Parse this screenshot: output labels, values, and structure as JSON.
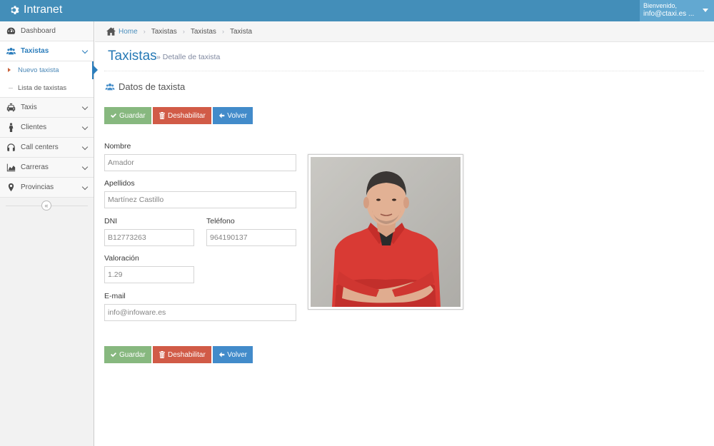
{
  "app": {
    "title": "Intranet"
  },
  "user": {
    "greeting": "Bienvenido,",
    "email": "info@ctaxi.es ..."
  },
  "sidebar": {
    "items": [
      {
        "label": "Dashboard",
        "icon": "dashboard-icon"
      },
      {
        "label": "Taxistas",
        "icon": "users-icon",
        "active": true,
        "children": [
          {
            "label": "Nuevo taxista"
          },
          {
            "label": "Lista de taxistas"
          }
        ]
      },
      {
        "label": "Taxis",
        "icon": "taxi-icon"
      },
      {
        "label": "Clientes",
        "icon": "person-icon"
      },
      {
        "label": "Call centers",
        "icon": "headphones-icon"
      },
      {
        "label": "Carreras",
        "icon": "area-chart-icon"
      },
      {
        "label": "Provincias",
        "icon": "map-marker-icon"
      }
    ],
    "collapse_glyph": "«"
  },
  "breadcrumb": {
    "home": "Home",
    "items": [
      "Taxistas",
      "Taxistas",
      "Taxista"
    ],
    "separator": "›"
  },
  "page": {
    "title": "Taxistas",
    "subtitle": "» Detalle de taxista"
  },
  "section": {
    "title": "Datos de taxista"
  },
  "buttons": {
    "save": "Guardar",
    "disable": "Deshabilitar",
    "back": "Volver"
  },
  "form": {
    "nombre": {
      "label": "Nombre",
      "value": "Amador"
    },
    "apellidos": {
      "label": "Apellidos",
      "value": "Martínez Castillo"
    },
    "dni": {
      "label": "DNI",
      "value": "B12773263"
    },
    "telefono": {
      "label": "Teléfono",
      "value": "964190137"
    },
    "valoracion": {
      "label": "Valoración",
      "value": "1.29"
    },
    "email": {
      "label": "E-mail",
      "value": "info@infoware.es"
    }
  },
  "colors": {
    "navbar": "#438eb9",
    "accent": "#2b7dbc",
    "save": "#87b87f",
    "disable": "#d15b47",
    "back": "#428bca"
  }
}
